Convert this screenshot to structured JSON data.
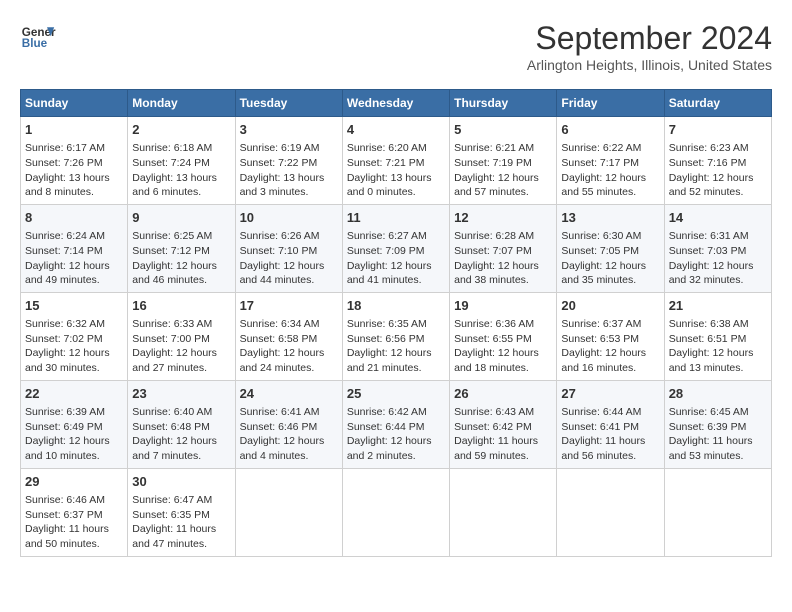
{
  "header": {
    "logo_line1": "General",
    "logo_line2": "Blue",
    "title": "September 2024",
    "subtitle": "Arlington Heights, Illinois, United States"
  },
  "columns": [
    "Sunday",
    "Monday",
    "Tuesday",
    "Wednesday",
    "Thursday",
    "Friday",
    "Saturday"
  ],
  "weeks": [
    [
      {
        "day": "1",
        "sunrise": "Sunrise: 6:17 AM",
        "sunset": "Sunset: 7:26 PM",
        "daylight": "Daylight: 13 hours and 8 minutes."
      },
      {
        "day": "2",
        "sunrise": "Sunrise: 6:18 AM",
        "sunset": "Sunset: 7:24 PM",
        "daylight": "Daylight: 13 hours and 6 minutes."
      },
      {
        "day": "3",
        "sunrise": "Sunrise: 6:19 AM",
        "sunset": "Sunset: 7:22 PM",
        "daylight": "Daylight: 13 hours and 3 minutes."
      },
      {
        "day": "4",
        "sunrise": "Sunrise: 6:20 AM",
        "sunset": "Sunset: 7:21 PM",
        "daylight": "Daylight: 13 hours and 0 minutes."
      },
      {
        "day": "5",
        "sunrise": "Sunrise: 6:21 AM",
        "sunset": "Sunset: 7:19 PM",
        "daylight": "Daylight: 12 hours and 57 minutes."
      },
      {
        "day": "6",
        "sunrise": "Sunrise: 6:22 AM",
        "sunset": "Sunset: 7:17 PM",
        "daylight": "Daylight: 12 hours and 55 minutes."
      },
      {
        "day": "7",
        "sunrise": "Sunrise: 6:23 AM",
        "sunset": "Sunset: 7:16 PM",
        "daylight": "Daylight: 12 hours and 52 minutes."
      }
    ],
    [
      {
        "day": "8",
        "sunrise": "Sunrise: 6:24 AM",
        "sunset": "Sunset: 7:14 PM",
        "daylight": "Daylight: 12 hours and 49 minutes."
      },
      {
        "day": "9",
        "sunrise": "Sunrise: 6:25 AM",
        "sunset": "Sunset: 7:12 PM",
        "daylight": "Daylight: 12 hours and 46 minutes."
      },
      {
        "day": "10",
        "sunrise": "Sunrise: 6:26 AM",
        "sunset": "Sunset: 7:10 PM",
        "daylight": "Daylight: 12 hours and 44 minutes."
      },
      {
        "day": "11",
        "sunrise": "Sunrise: 6:27 AM",
        "sunset": "Sunset: 7:09 PM",
        "daylight": "Daylight: 12 hours and 41 minutes."
      },
      {
        "day": "12",
        "sunrise": "Sunrise: 6:28 AM",
        "sunset": "Sunset: 7:07 PM",
        "daylight": "Daylight: 12 hours and 38 minutes."
      },
      {
        "day": "13",
        "sunrise": "Sunrise: 6:30 AM",
        "sunset": "Sunset: 7:05 PM",
        "daylight": "Daylight: 12 hours and 35 minutes."
      },
      {
        "day": "14",
        "sunrise": "Sunrise: 6:31 AM",
        "sunset": "Sunset: 7:03 PM",
        "daylight": "Daylight: 12 hours and 32 minutes."
      }
    ],
    [
      {
        "day": "15",
        "sunrise": "Sunrise: 6:32 AM",
        "sunset": "Sunset: 7:02 PM",
        "daylight": "Daylight: 12 hours and 30 minutes."
      },
      {
        "day": "16",
        "sunrise": "Sunrise: 6:33 AM",
        "sunset": "Sunset: 7:00 PM",
        "daylight": "Daylight: 12 hours and 27 minutes."
      },
      {
        "day": "17",
        "sunrise": "Sunrise: 6:34 AM",
        "sunset": "Sunset: 6:58 PM",
        "daylight": "Daylight: 12 hours and 24 minutes."
      },
      {
        "day": "18",
        "sunrise": "Sunrise: 6:35 AM",
        "sunset": "Sunset: 6:56 PM",
        "daylight": "Daylight: 12 hours and 21 minutes."
      },
      {
        "day": "19",
        "sunrise": "Sunrise: 6:36 AM",
        "sunset": "Sunset: 6:55 PM",
        "daylight": "Daylight: 12 hours and 18 minutes."
      },
      {
        "day": "20",
        "sunrise": "Sunrise: 6:37 AM",
        "sunset": "Sunset: 6:53 PM",
        "daylight": "Daylight: 12 hours and 16 minutes."
      },
      {
        "day": "21",
        "sunrise": "Sunrise: 6:38 AM",
        "sunset": "Sunset: 6:51 PM",
        "daylight": "Daylight: 12 hours and 13 minutes."
      }
    ],
    [
      {
        "day": "22",
        "sunrise": "Sunrise: 6:39 AM",
        "sunset": "Sunset: 6:49 PM",
        "daylight": "Daylight: 12 hours and 10 minutes."
      },
      {
        "day": "23",
        "sunrise": "Sunrise: 6:40 AM",
        "sunset": "Sunset: 6:48 PM",
        "daylight": "Daylight: 12 hours and 7 minutes."
      },
      {
        "day": "24",
        "sunrise": "Sunrise: 6:41 AM",
        "sunset": "Sunset: 6:46 PM",
        "daylight": "Daylight: 12 hours and 4 minutes."
      },
      {
        "day": "25",
        "sunrise": "Sunrise: 6:42 AM",
        "sunset": "Sunset: 6:44 PM",
        "daylight": "Daylight: 12 hours and 2 minutes."
      },
      {
        "day": "26",
        "sunrise": "Sunrise: 6:43 AM",
        "sunset": "Sunset: 6:42 PM",
        "daylight": "Daylight: 11 hours and 59 minutes."
      },
      {
        "day": "27",
        "sunrise": "Sunrise: 6:44 AM",
        "sunset": "Sunset: 6:41 PM",
        "daylight": "Daylight: 11 hours and 56 minutes."
      },
      {
        "day": "28",
        "sunrise": "Sunrise: 6:45 AM",
        "sunset": "Sunset: 6:39 PM",
        "daylight": "Daylight: 11 hours and 53 minutes."
      }
    ],
    [
      {
        "day": "29",
        "sunrise": "Sunrise: 6:46 AM",
        "sunset": "Sunset: 6:37 PM",
        "daylight": "Daylight: 11 hours and 50 minutes."
      },
      {
        "day": "30",
        "sunrise": "Sunrise: 6:47 AM",
        "sunset": "Sunset: 6:35 PM",
        "daylight": "Daylight: 11 hours and 47 minutes."
      },
      null,
      null,
      null,
      null,
      null
    ]
  ]
}
